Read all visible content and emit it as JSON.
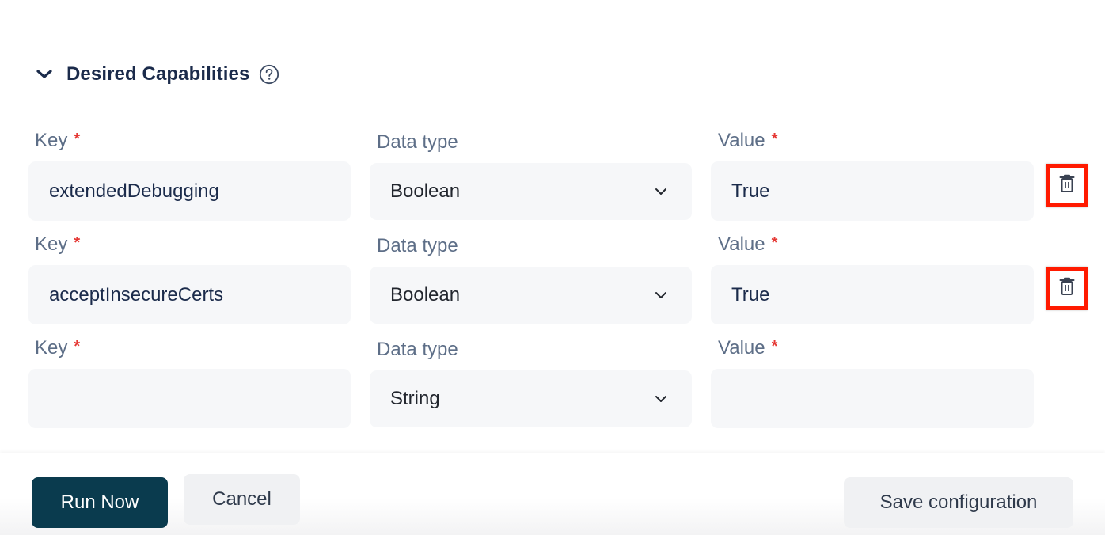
{
  "section": {
    "title": "Desired Capabilities",
    "expanded": true,
    "toggle_icon": "chevron-down-icon",
    "help_icon": "help-circle-icon"
  },
  "labels": {
    "key": "Key",
    "data_type": "Data type",
    "value": "Value",
    "required_marker": "*"
  },
  "capabilities": [
    {
      "key": "extendedDebugging",
      "data_type": "Boolean",
      "value": "True",
      "deletable": true
    },
    {
      "key": "acceptInsecureCerts",
      "data_type": "Boolean",
      "value": "True",
      "deletable": true
    },
    {
      "key": "",
      "data_type": "String",
      "value": "",
      "deletable": false
    }
  ],
  "icons": {
    "select_chevron": "chevron-down-icon",
    "delete": "trash-icon"
  },
  "colors": {
    "primary_button": "#0a3b4e",
    "title_text": "#1b2b4b",
    "label_text": "#5d6e87",
    "required": "#e53935",
    "field_bg": "#f6f7f9",
    "highlight_border": "#ff1a00"
  },
  "footer": {
    "run_now_label": "Run Now",
    "cancel_label": "Cancel",
    "save_label": "Save configuration"
  }
}
